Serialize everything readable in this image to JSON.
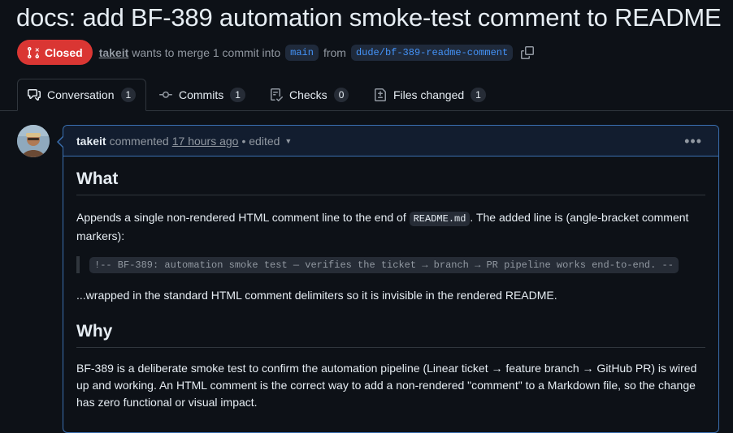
{
  "pr": {
    "title": "docs: add BF-389 automation smoke-test comment to README",
    "state": "Closed",
    "author": "takeit",
    "merge_text": "wants to merge 1 commit into",
    "base_branch": "main",
    "from_text": "from",
    "head_branch": "dude/bf-389-readme-comment"
  },
  "tabs": [
    {
      "label": "Conversation",
      "count": "1",
      "icon": "comment-discussion-icon"
    },
    {
      "label": "Commits",
      "count": "1",
      "icon": "git-commit-icon"
    },
    {
      "label": "Checks",
      "count": "0",
      "icon": "checklist-icon"
    },
    {
      "label": "Files changed",
      "count": "1",
      "icon": "file-diff-icon"
    }
  ],
  "comment": {
    "author": "takeit",
    "action": "commented",
    "time": "17 hours ago",
    "edited": "• edited",
    "what_heading": "What",
    "what_p1_before": "Appends a single non-rendered HTML comment line to the end of ",
    "what_p1_code": "README.md",
    "what_p1_after": ". The added line is (angle-bracket comment markers):",
    "quote_code": "!-- BF-389: automation smoke test — verifies the ticket → branch → PR pipeline works end-to-end. --",
    "what_p2": "...wrapped in the standard HTML comment delimiters so it is invisible in the rendered README.",
    "why_heading": "Why",
    "why_p1": "BF-389 is a deliberate smoke test to confirm the automation pipeline (Linear ticket → feature branch → GitHub PR) is wired up and working. An HTML comment is the correct way to add a non-rendered \"comment\" to a Markdown file, so the change has zero functional or visual impact."
  },
  "colors": {
    "background": "#0d1117",
    "closed_badge": "#da3633",
    "branch_link": "#4493f8",
    "comment_border": "#3a6fb0"
  }
}
